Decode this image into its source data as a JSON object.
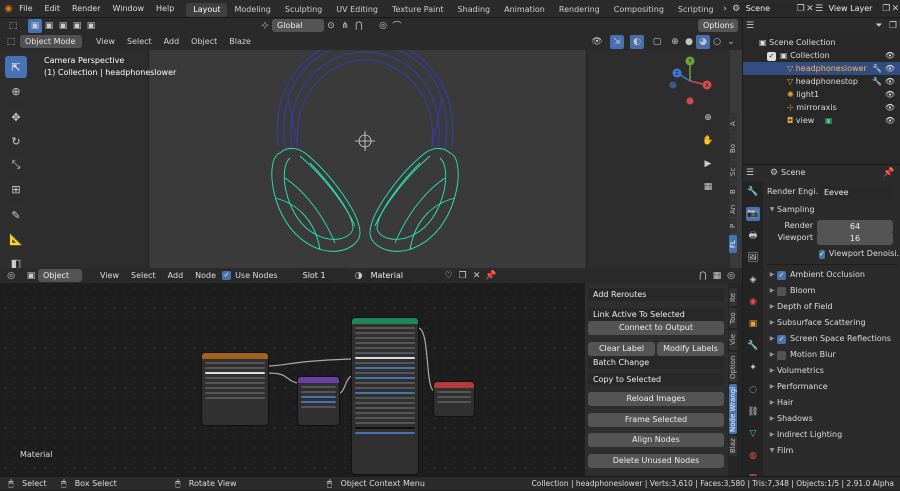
{
  "topbar": {
    "menu": [
      "File",
      "Edit",
      "Render",
      "Window",
      "Help"
    ],
    "workspaces": [
      "Layout",
      "Modeling",
      "Sculpting",
      "UV Editing",
      "Texture Paint",
      "Shading",
      "Animation",
      "Rendering",
      "Compositing",
      "Scripting"
    ],
    "active_workspace": "Layout",
    "scene": "Scene",
    "view_layer": "View Layer"
  },
  "tool_header": {
    "orientation": "Global",
    "options": "Options"
  },
  "viewport": {
    "mode": "Object Mode",
    "menus": [
      "View",
      "Select",
      "Add",
      "Object",
      "Blaze"
    ],
    "overlay_title": "Camera Perspective",
    "overlay_subtitle": "(1) Collection | headphoneslower",
    "side_tabs": [
      "A",
      "Bo",
      "Sc",
      "B",
      "An",
      "P",
      "FL"
    ],
    "gizmo": {
      "y": "Y",
      "z": "Z",
      "x": "X"
    }
  },
  "node_header": {
    "type": "Object",
    "menus": [
      "View",
      "Select",
      "Add",
      "Node"
    ],
    "use_nodes": "Use Nodes",
    "slot": "Slot 1",
    "material": "Material"
  },
  "node_editor": {
    "label": "Material"
  },
  "node_panel": {
    "add_reroutes": "Add Reroutes",
    "link_active": "Link Active To Selected",
    "connect_output": "Connect to Output",
    "clear_label": "Clear Label",
    "modify_labels": "Modify Labels",
    "batch_change": "Batch Change",
    "copy_selected": "Copy to Selected",
    "reload_images": "Reload Images",
    "frame_selected": "Frame Selected",
    "align_nodes": "Align Nodes",
    "delete_unused": "Delete Unused Nodes",
    "tabs": [
      "Ite",
      "Too",
      "Vie",
      "Option",
      "Node Wrangl",
      "Blaz"
    ]
  },
  "outliner": {
    "scene_collection": "Scene Collection",
    "collection": "Collection",
    "items": [
      {
        "name": "headphoneslower",
        "selected": true
      },
      {
        "name": "headphonestop",
        "selected": false
      },
      {
        "name": "light1",
        "selected": false
      },
      {
        "name": "mirroraxis",
        "selected": false
      },
      {
        "name": "view",
        "selected": false
      }
    ]
  },
  "properties": {
    "breadcrumb": "Scene",
    "render_engine_label": "Render Engi...",
    "render_engine": "Eevee",
    "sampling": "Sampling",
    "render_label": "Render",
    "render_value": "64",
    "viewport_label": "Viewport",
    "viewport_value": "16",
    "viewport_denoise": "Viewport Denoisi...",
    "panels": [
      {
        "label": "Ambient Occlusion",
        "checkbox": true,
        "checked": true
      },
      {
        "label": "Bloom",
        "checkbox": true,
        "checked": false
      },
      {
        "label": "Depth of Field",
        "checkbox": false
      },
      {
        "label": "Subsurface Scattering",
        "checkbox": false
      },
      {
        "label": "Screen Space Reflections",
        "checkbox": true,
        "checked": true
      },
      {
        "label": "Motion Blur",
        "checkbox": true,
        "checked": false
      },
      {
        "label": "Volumetrics",
        "checkbox": false
      },
      {
        "label": "Performance",
        "checkbox": false
      },
      {
        "label": "Hair",
        "checkbox": false
      },
      {
        "label": "Shadows",
        "checkbox": false
      },
      {
        "label": "Indirect Lighting",
        "checkbox": false
      },
      {
        "label": "Film",
        "checkbox": false
      }
    ]
  },
  "statusbar": {
    "select": "Select",
    "box_select": "Box Select",
    "rotate_view": "Rotate View",
    "context_menu": "Object Context Menu",
    "stats": "Collection | headphoneslower | Verts:3,610 | Faces:3,580 | Tris:7,348 | Objects:1/5 | 2.91.0 Alpha"
  },
  "colors": {
    "accent": "#4772b3",
    "selected_row": "#334d80",
    "mesh_lower": "#2ee6b0",
    "mesh_top": "#3a3aa0"
  }
}
